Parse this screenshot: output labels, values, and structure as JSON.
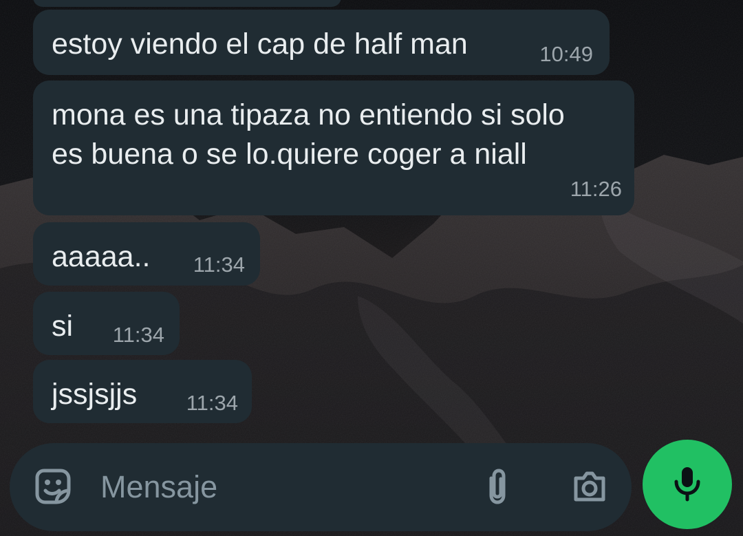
{
  "conversation": {
    "messages": [
      {
        "text": "",
        "time": ""
      },
      {
        "text": "estoy viendo el cap de half man",
        "time": "10:49"
      },
      {
        "text": "mona es una tipaza no entiendo si solo\nes buena o se lo.quiere coger a niall",
        "time": "11:26"
      },
      {
        "text": "aaaaa..",
        "time": "11:34"
      },
      {
        "text": "si",
        "time": "11:34"
      },
      {
        "text": "jssjsjjs",
        "time": "11:34"
      }
    ]
  },
  "composer": {
    "placeholder": "Mensaje"
  },
  "icons": {
    "emoji": "emoji-sticker-icon",
    "attach": "paperclip-icon",
    "camera": "camera-icon",
    "mic": "microphone-icon"
  },
  "colors": {
    "bubble": "#202c33",
    "secondary_text": "#8696a0",
    "accent": "#21c063"
  }
}
